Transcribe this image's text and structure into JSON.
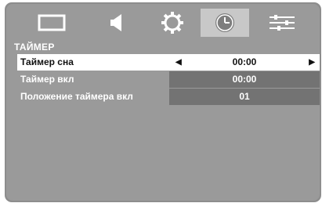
{
  "menu": {
    "tabs": [
      {
        "name": "picture",
        "icon": "tv-screen-icon",
        "active": false
      },
      {
        "name": "sound",
        "icon": "speaker-icon",
        "active": false
      },
      {
        "name": "setup",
        "icon": "gear-icon",
        "active": false
      },
      {
        "name": "timer",
        "icon": "clock-icon",
        "active": true
      },
      {
        "name": "options",
        "icon": "sliders-icon",
        "active": false
      }
    ],
    "title": "ТАЙМЕР",
    "rows": [
      {
        "label": "Таймер сна",
        "value": "00:00",
        "selected": true
      },
      {
        "label": "Таймер вкл",
        "value": "00:00",
        "selected": false
      },
      {
        "label": "Положение таймера вкл",
        "value": "01",
        "selected": false
      }
    ]
  }
}
